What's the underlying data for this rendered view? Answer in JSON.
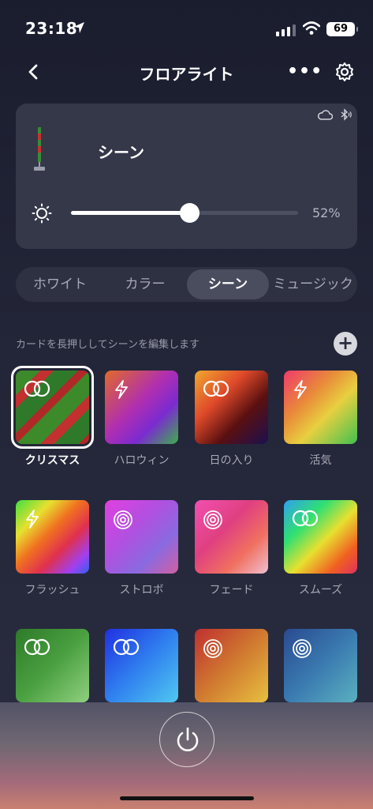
{
  "status": {
    "time": "23:18",
    "battery": "69"
  },
  "nav": {
    "title": "フロアライト",
    "more": "•••"
  },
  "device": {
    "scene": "シーン",
    "brightness": "52%",
    "brightness_value": 0.52
  },
  "tabs": [
    "ホワイト",
    "カラー",
    "シーン",
    "ミュージック"
  ],
  "active_tab": "シーン",
  "hint": "カードを長押ししてシーンを編集します",
  "add": "+",
  "scenes": [
    {
      "label": "クリスマス",
      "icon": "rings-icon",
      "selected": true
    },
    {
      "label": "ハロウィン",
      "icon": "bolt-icon"
    },
    {
      "label": "日の入り",
      "icon": "rings-icon"
    },
    {
      "label": "活気",
      "icon": "bolt-icon"
    },
    {
      "label": "フラッシュ",
      "icon": "bolt-icon"
    },
    {
      "label": "ストロボ",
      "icon": "concentric-icon"
    },
    {
      "label": "フェード",
      "icon": "concentric-icon"
    },
    {
      "label": "スムーズ",
      "icon": "rings-icon"
    },
    {
      "label": "",
      "icon": "rings-icon"
    },
    {
      "label": "",
      "icon": "rings-icon"
    },
    {
      "label": "",
      "icon": "concentric-icon"
    },
    {
      "label": "",
      "icon": "concentric-icon"
    }
  ]
}
